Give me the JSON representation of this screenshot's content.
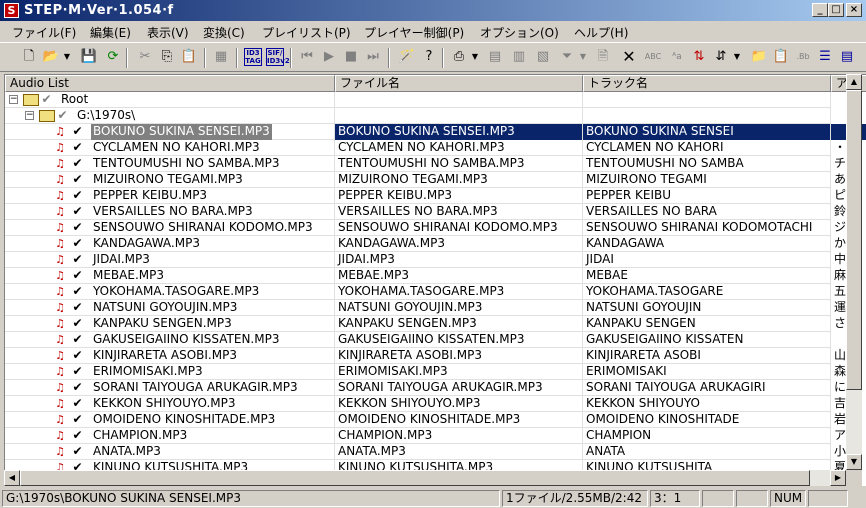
{
  "window": {
    "title": "STEP·M·Ver·1.054·f",
    "app_icon_letter": "S",
    "minimize": "_",
    "maximize": "□",
    "close": "×"
  },
  "menu": [
    "ファイル(F)",
    "編集(E)",
    "表示(V)",
    "変換(C)",
    "プレイリスト(P)",
    "プレイヤー制御(P)",
    "オプション(O)",
    "ヘルプ(H)"
  ],
  "toolbar": {
    "id3_tag": "ID3 TAG",
    "sif_id3": "SIF/ ID3v2"
  },
  "columns": [
    "Audio List",
    "ファイル名",
    "トラック名",
    "ア"
  ],
  "tree": {
    "root_label": "Root",
    "folder_label": "G:\\1970s\\"
  },
  "rows": [
    {
      "file": "BOKUNO SUKINA SENSEI.MP3",
      "track": "BOKUNO SUKINA SENSEI",
      "artist": "",
      "selected": true
    },
    {
      "file": "CYCLAMEN NO KAHORI.MP3",
      "track": "CYCLAMEN NO KAHORI",
      "artist": "・"
    },
    {
      "file": "TENTOUMUSHI NO SAMBA.MP3",
      "track": "TENTOUMUSHI NO SAMBA",
      "artist": "チ"
    },
    {
      "file": "MIZUIRONO TEGAMI.MP3",
      "track": "MIZUIRONO TEGAMI",
      "artist": "あ"
    },
    {
      "file": "PEPPER KEIBU.MP3",
      "track": "PEPPER KEIBU",
      "artist": "ピ"
    },
    {
      "file": "VERSAILLES NO BARA.MP3",
      "track": "VERSAILLES NO BARA",
      "artist": "鈴"
    },
    {
      "file": "SENSOUWO SHIRANAI KODOMO.MP3",
      "track": "SENSOUWO SHIRANAI KODOMOTACHI",
      "artist": "ジ"
    },
    {
      "file": "KANDAGAWA.MP3",
      "track": "KANDAGAWA",
      "artist": "か"
    },
    {
      "file": "JIDAI.MP3",
      "track": "JIDAI",
      "artist": "中"
    },
    {
      "file": "MEBAE.MP3",
      "track": "MEBAE",
      "artist": "麻"
    },
    {
      "file": "YOKOHAMA.TASOGARE.MP3",
      "track": "YOKOHAMA.TASOGARE",
      "artist": "五"
    },
    {
      "file": "NATSUNI GOYOUJIN.MP3",
      "track": "NATSUNI GOYOUJIN",
      "artist": "運"
    },
    {
      "file": "KANPAKU SENGEN.MP3",
      "track": "KANPAKU SENGEN",
      "artist": "さ"
    },
    {
      "file": "GAKUSEIGAIINO KISSATEN.MP3",
      "track": "GAKUSEIGAIINO KISSATEN",
      "artist": ""
    },
    {
      "file": "KINJIRARETA ASOBI.MP3",
      "track": "KINJIRARETA ASOBI",
      "artist": "山"
    },
    {
      "file": "ERIMOMISAKI.MP3",
      "track": "ERIMOMISAKI",
      "artist": "森"
    },
    {
      "file": "SORANI TAIYOUGA ARUKAGIR.MP3",
      "track": "SORANI TAIYOUGA ARUKAGIRI",
      "artist": "に"
    },
    {
      "file": "KEKKON SHIYOUYO.MP3",
      "track": "KEKKON SHIYOUYO",
      "artist": "吉"
    },
    {
      "file": "OMOIDENO KINOSHITADE.MP3",
      "track": "OMOIDENO KINOSHITADE",
      "artist": "岩"
    },
    {
      "file": "CHAMPION.MP3",
      "track": "CHAMPION",
      "artist": "ア"
    },
    {
      "file": "ANATA.MP3",
      "track": "ANATA",
      "artist": "小"
    },
    {
      "file": "KINUNO KUTSUSHITA.MP3",
      "track": "KINUNO KUTSUSHITA",
      "artist": "夏"
    }
  ],
  "status": {
    "path": "G:\\1970s\\BOKUNO SUKINA SENSEI.MP3",
    "info": "1ファイル/2.55MB/2:42",
    "ratio": "3：1",
    "blank1": "",
    "blank2": "",
    "num": "NUM"
  }
}
